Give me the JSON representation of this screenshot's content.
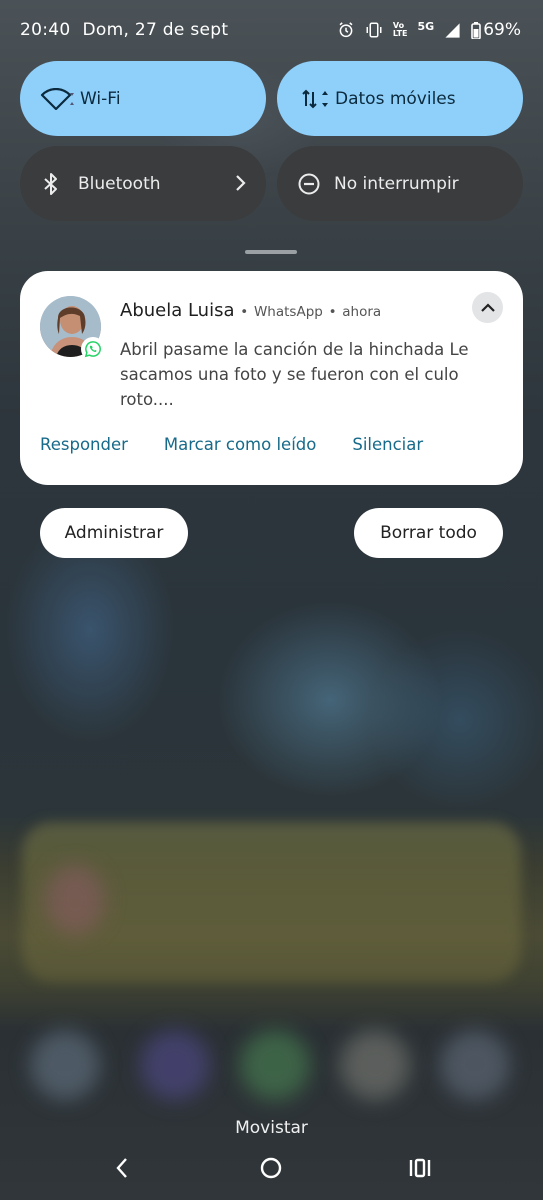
{
  "status_bar": {
    "time": "20:40",
    "date": "Dom, 27 de sept",
    "battery": "69%",
    "network_badge": "5G",
    "volte_label_top": "Vo",
    "volte_label_bottom": "LTE",
    "icons": [
      "alarm-icon",
      "vibrate-icon",
      "volte-icon",
      "signal-icon",
      "battery-icon"
    ]
  },
  "quick_settings": {
    "tiles": [
      {
        "label": "Wi-Fi",
        "state": "on",
        "icon": "wifi-icon"
      },
      {
        "label": "Datos móviles",
        "state": "on",
        "icon": "mobile-data-icon"
      },
      {
        "label": "Bluetooth",
        "state": "off",
        "icon": "bluetooth-icon"
      },
      {
        "label": "No interrumpir",
        "state": "off",
        "icon": "dnd-icon"
      }
    ]
  },
  "notification": {
    "sender": "Abuela Luisa",
    "app": "WhatsApp",
    "time": "ahora",
    "separator": "•",
    "message": "Abril pasame la canción de la hinchada Le sacamos una foto y se fueron con el culo roto....",
    "actions": [
      "Responder",
      "Marcar como leído",
      "Silenciar"
    ]
  },
  "shade_buttons": {
    "manage": "Administrar",
    "clear_all": "Borrar todo"
  },
  "carrier": "Movistar",
  "colors": {
    "tile_on": "#8fd0fb",
    "tile_off": "#3a3c3e",
    "action_text": "#176a8a",
    "whatsapp_green": "#25d366"
  }
}
